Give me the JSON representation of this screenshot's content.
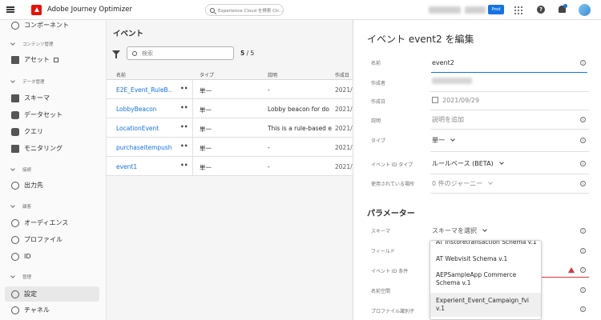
{
  "topbar": {
    "app_title": "Adobe Journey Optimizer",
    "search_placeholder": "Experience Cloud を検索 Ctr...",
    "env_button": "Prod"
  },
  "sidebar": {
    "items": [
      {
        "label": "コンポーネント"
      },
      {
        "label": "アセット"
      },
      {
        "label": "スキーマ"
      },
      {
        "label": "データセット"
      },
      {
        "label": "クエリ"
      },
      {
        "label": "モニタリング"
      },
      {
        "label": "出力先"
      },
      {
        "label": "オーディエンス"
      },
      {
        "label": "プロファイル"
      },
      {
        "label": "ID"
      },
      {
        "label": "設定"
      },
      {
        "label": "チャネル"
      }
    ],
    "sections": [
      {
        "label": "コンテンツ管理"
      },
      {
        "label": "データ管理"
      },
      {
        "label": "接続"
      },
      {
        "label": "顧客"
      },
      {
        "label": "管理"
      }
    ]
  },
  "list": {
    "title": "イベント",
    "search_placeholder": "検索",
    "count_shown": "5",
    "count_sep": "/",
    "count_total": "5",
    "columns": [
      "名前",
      "タイプ",
      "説明",
      "作成日"
    ],
    "rows": [
      {
        "name": "E2E_Event_RuleB...",
        "dots": "•••",
        "type": "単一",
        "desc": "-",
        "date": "2021/0"
      },
      {
        "name": "LobbyBeacon",
        "dots": "•••",
        "type": "単一",
        "desc": "Lobby beacon for do",
        "date": "2021/0"
      },
      {
        "name": "LocationEvent",
        "dots": "•••",
        "type": "単一",
        "desc": "This is a rule-based e",
        "date": "2021/0"
      },
      {
        "name": "purchaseitempush",
        "dots": "•••",
        "type": "単一",
        "desc": "-",
        "date": "2021/0"
      },
      {
        "name": "event1",
        "dots": "•••",
        "type": "単一",
        "desc": "-",
        "date": "2021/0"
      }
    ]
  },
  "edit": {
    "title": "イベント event2 を編集",
    "labels": {
      "name": "名前",
      "author": "作成者",
      "created": "作成日",
      "description": "説明",
      "type": "タイプ",
      "event_id_type": "イベント ID タイプ",
      "used_in": "使用されている場所",
      "schema": "スキーマ",
      "fields": "フィールド",
      "event_id_condition": "イベント ID 条件",
      "namespace": "名前空間",
      "profile_identifier": "プロファイル識別子"
    },
    "values": {
      "name": "event2",
      "created": "2021/09/29",
      "description_placeholder": "説明を追加",
      "type": "単一",
      "event_id_type": "ルールベース (BETA)",
      "used_in": "0 件のジャーニー",
      "schema_placeholder": "スキーマを選択"
    },
    "section_title": "パラメーター",
    "info_glyph": "i"
  },
  "schema_dropdown": {
    "options": [
      "AT Instoretransaction Schema v.1",
      "AT Webvisit Schema v.1",
      "AEPSampleApp Commerce Schema v.1",
      "Experient_Event_Campaign_fvi v.1"
    ]
  }
}
